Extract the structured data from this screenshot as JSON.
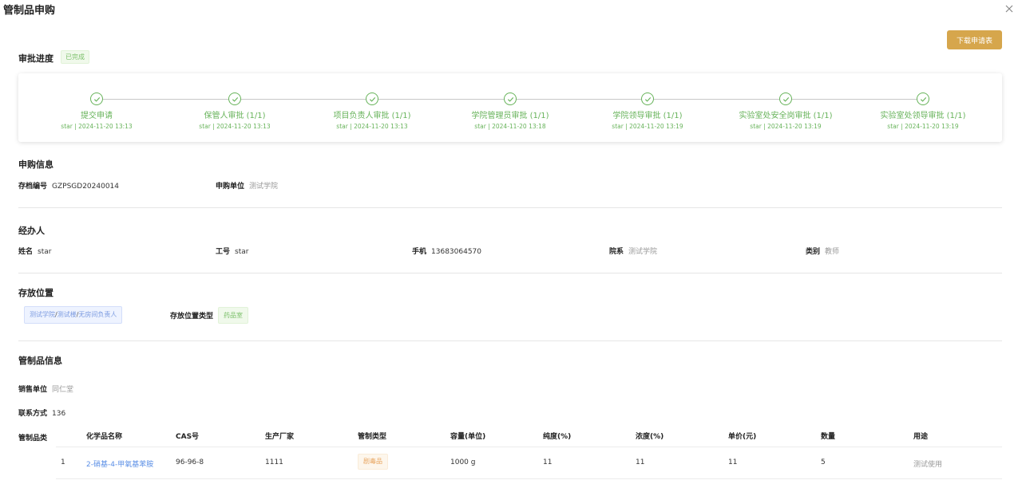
{
  "dialog": {
    "title": "管制品申购"
  },
  "toolbar": {
    "download_label": "下载申请表"
  },
  "progress": {
    "title": "审批进度",
    "status": "已完成",
    "steps": [
      {
        "title": "提交申请",
        "sub": "star | 2024-11-20 13:13"
      },
      {
        "title": "保管人审批 (1/1)",
        "sub": "star | 2024-11-20 13:13"
      },
      {
        "title": "项目负责人审批 (1/1)",
        "sub": "star | 2024-11-20 13:13"
      },
      {
        "title": "学院管理员审批 (1/1)",
        "sub": "star | 2024-11-20 13:18"
      },
      {
        "title": "学院领导审批 (1/1)",
        "sub": "star | 2024-11-20 13:19"
      },
      {
        "title": "实验室处安全岗审批 (1/1)",
        "sub": "star | 2024-11-20 13:19"
      },
      {
        "title": "实验室处领导审批 (1/1)",
        "sub": "star | 2024-11-20 13:19"
      }
    ]
  },
  "purchase_info": {
    "title": "申购信息",
    "archive_label": "存档编号",
    "archive_value": "GZPSGD20240014",
    "unit_label": "申购单位",
    "unit_value": "测试学院"
  },
  "handler": {
    "title": "经办人",
    "name_label": "姓名",
    "name_value": "star",
    "id_label": "工号",
    "id_value": "star",
    "phone_label": "手机",
    "phone_value": "13683064570",
    "dept_label": "院系",
    "dept_value": "测试学院",
    "category_label": "类别",
    "category_value": "教师"
  },
  "storage": {
    "title": "存放位置",
    "path": [
      "测试学院",
      "测试楼",
      "无房间负责人"
    ],
    "type_label": "存放位置类型",
    "type_value": "药品室"
  },
  "controlled": {
    "title": "管制品信息",
    "seller_label": "销售单位",
    "seller_value": "同仁堂",
    "contact_label": "联系方式",
    "contact_value": "136",
    "category_label": "管制品类",
    "columns": [
      "化学品名称",
      "CAS号",
      "生产厂家",
      "管制类型",
      "容量(单位)",
      "纯度(%)",
      "浓度(%)",
      "单价(元)",
      "数量",
      "用途"
    ],
    "rows": [
      {
        "index": "1",
        "name": "2-硝基-4-甲氧基苯胺",
        "cas": "96-96-8",
        "maker": "1111",
        "control_type": "剧毒品",
        "capacity": "1000 g",
        "purity": "11",
        "concentration": "11",
        "price": "11",
        "qty": "5",
        "usage": "测试使用"
      }
    ]
  }
}
